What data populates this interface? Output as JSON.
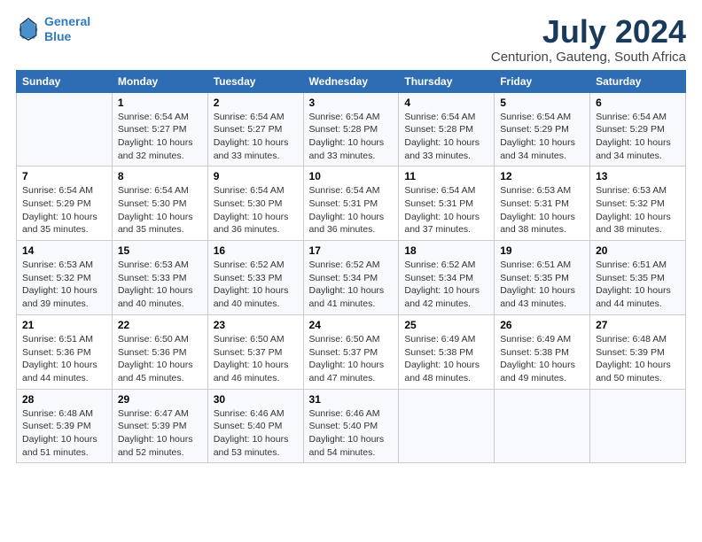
{
  "logo": {
    "line1": "General",
    "line2": "Blue"
  },
  "title": "July 2024",
  "subtitle": "Centurion, Gauteng, South Africa",
  "header": {
    "accent_color": "#2e6db4"
  },
  "days": [
    "Sunday",
    "Monday",
    "Tuesday",
    "Wednesday",
    "Thursday",
    "Friday",
    "Saturday"
  ],
  "weeks": [
    [
      {
        "date": "",
        "sunrise": "",
        "sunset": "",
        "daylight": ""
      },
      {
        "date": "1",
        "sunrise": "Sunrise: 6:54 AM",
        "sunset": "Sunset: 5:27 PM",
        "daylight": "Daylight: 10 hours and 32 minutes."
      },
      {
        "date": "2",
        "sunrise": "Sunrise: 6:54 AM",
        "sunset": "Sunset: 5:27 PM",
        "daylight": "Daylight: 10 hours and 33 minutes."
      },
      {
        "date": "3",
        "sunrise": "Sunrise: 6:54 AM",
        "sunset": "Sunset: 5:28 PM",
        "daylight": "Daylight: 10 hours and 33 minutes."
      },
      {
        "date": "4",
        "sunrise": "Sunrise: 6:54 AM",
        "sunset": "Sunset: 5:28 PM",
        "daylight": "Daylight: 10 hours and 33 minutes."
      },
      {
        "date": "5",
        "sunrise": "Sunrise: 6:54 AM",
        "sunset": "Sunset: 5:29 PM",
        "daylight": "Daylight: 10 hours and 34 minutes."
      },
      {
        "date": "6",
        "sunrise": "Sunrise: 6:54 AM",
        "sunset": "Sunset: 5:29 PM",
        "daylight": "Daylight: 10 hours and 34 minutes."
      }
    ],
    [
      {
        "date": "7",
        "sunrise": "Sunrise: 6:54 AM",
        "sunset": "Sunset: 5:29 PM",
        "daylight": "Daylight: 10 hours and 35 minutes."
      },
      {
        "date": "8",
        "sunrise": "Sunrise: 6:54 AM",
        "sunset": "Sunset: 5:30 PM",
        "daylight": "Daylight: 10 hours and 35 minutes."
      },
      {
        "date": "9",
        "sunrise": "Sunrise: 6:54 AM",
        "sunset": "Sunset: 5:30 PM",
        "daylight": "Daylight: 10 hours and 36 minutes."
      },
      {
        "date": "10",
        "sunrise": "Sunrise: 6:54 AM",
        "sunset": "Sunset: 5:31 PM",
        "daylight": "Daylight: 10 hours and 36 minutes."
      },
      {
        "date": "11",
        "sunrise": "Sunrise: 6:54 AM",
        "sunset": "Sunset: 5:31 PM",
        "daylight": "Daylight: 10 hours and 37 minutes."
      },
      {
        "date": "12",
        "sunrise": "Sunrise: 6:53 AM",
        "sunset": "Sunset: 5:31 PM",
        "daylight": "Daylight: 10 hours and 38 minutes."
      },
      {
        "date": "13",
        "sunrise": "Sunrise: 6:53 AM",
        "sunset": "Sunset: 5:32 PM",
        "daylight": "Daylight: 10 hours and 38 minutes."
      }
    ],
    [
      {
        "date": "14",
        "sunrise": "Sunrise: 6:53 AM",
        "sunset": "Sunset: 5:32 PM",
        "daylight": "Daylight: 10 hours and 39 minutes."
      },
      {
        "date": "15",
        "sunrise": "Sunrise: 6:53 AM",
        "sunset": "Sunset: 5:33 PM",
        "daylight": "Daylight: 10 hours and 40 minutes."
      },
      {
        "date": "16",
        "sunrise": "Sunrise: 6:52 AM",
        "sunset": "Sunset: 5:33 PM",
        "daylight": "Daylight: 10 hours and 40 minutes."
      },
      {
        "date": "17",
        "sunrise": "Sunrise: 6:52 AM",
        "sunset": "Sunset: 5:34 PM",
        "daylight": "Daylight: 10 hours and 41 minutes."
      },
      {
        "date": "18",
        "sunrise": "Sunrise: 6:52 AM",
        "sunset": "Sunset: 5:34 PM",
        "daylight": "Daylight: 10 hours and 42 minutes."
      },
      {
        "date": "19",
        "sunrise": "Sunrise: 6:51 AM",
        "sunset": "Sunset: 5:35 PM",
        "daylight": "Daylight: 10 hours and 43 minutes."
      },
      {
        "date": "20",
        "sunrise": "Sunrise: 6:51 AM",
        "sunset": "Sunset: 5:35 PM",
        "daylight": "Daylight: 10 hours and 44 minutes."
      }
    ],
    [
      {
        "date": "21",
        "sunrise": "Sunrise: 6:51 AM",
        "sunset": "Sunset: 5:36 PM",
        "daylight": "Daylight: 10 hours and 44 minutes."
      },
      {
        "date": "22",
        "sunrise": "Sunrise: 6:50 AM",
        "sunset": "Sunset: 5:36 PM",
        "daylight": "Daylight: 10 hours and 45 minutes."
      },
      {
        "date": "23",
        "sunrise": "Sunrise: 6:50 AM",
        "sunset": "Sunset: 5:37 PM",
        "daylight": "Daylight: 10 hours and 46 minutes."
      },
      {
        "date": "24",
        "sunrise": "Sunrise: 6:50 AM",
        "sunset": "Sunset: 5:37 PM",
        "daylight": "Daylight: 10 hours and 47 minutes."
      },
      {
        "date": "25",
        "sunrise": "Sunrise: 6:49 AM",
        "sunset": "Sunset: 5:38 PM",
        "daylight": "Daylight: 10 hours and 48 minutes."
      },
      {
        "date": "26",
        "sunrise": "Sunrise: 6:49 AM",
        "sunset": "Sunset: 5:38 PM",
        "daylight": "Daylight: 10 hours and 49 minutes."
      },
      {
        "date": "27",
        "sunrise": "Sunrise: 6:48 AM",
        "sunset": "Sunset: 5:39 PM",
        "daylight": "Daylight: 10 hours and 50 minutes."
      }
    ],
    [
      {
        "date": "28",
        "sunrise": "Sunrise: 6:48 AM",
        "sunset": "Sunset: 5:39 PM",
        "daylight": "Daylight: 10 hours and 51 minutes."
      },
      {
        "date": "29",
        "sunrise": "Sunrise: 6:47 AM",
        "sunset": "Sunset: 5:39 PM",
        "daylight": "Daylight: 10 hours and 52 minutes."
      },
      {
        "date": "30",
        "sunrise": "Sunrise: 6:46 AM",
        "sunset": "Sunset: 5:40 PM",
        "daylight": "Daylight: 10 hours and 53 minutes."
      },
      {
        "date": "31",
        "sunrise": "Sunrise: 6:46 AM",
        "sunset": "Sunset: 5:40 PM",
        "daylight": "Daylight: 10 hours and 54 minutes."
      },
      {
        "date": "",
        "sunrise": "",
        "sunset": "",
        "daylight": ""
      },
      {
        "date": "",
        "sunrise": "",
        "sunset": "",
        "daylight": ""
      },
      {
        "date": "",
        "sunrise": "",
        "sunset": "",
        "daylight": ""
      }
    ]
  ]
}
